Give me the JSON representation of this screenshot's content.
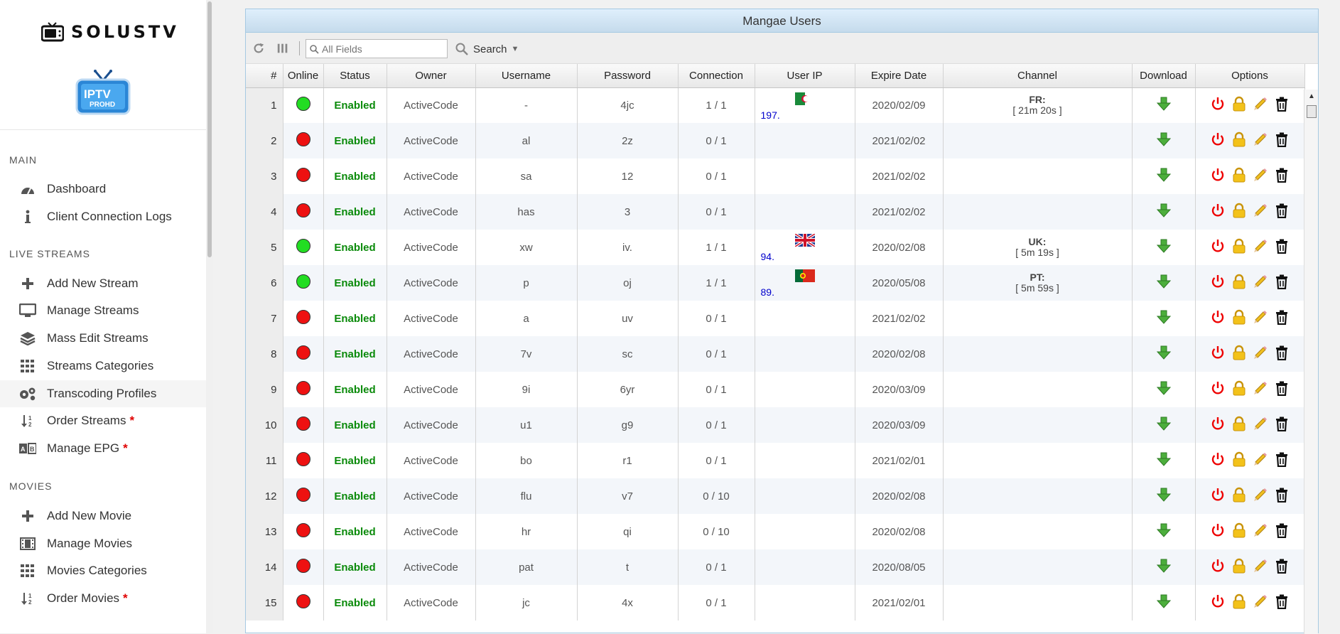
{
  "brand": {
    "name": "SOLUSTV",
    "logo_text_top": "IPTV",
    "logo_text_bottom": "PROHD"
  },
  "sidebar": {
    "sections": [
      {
        "title": "MAIN",
        "items": [
          {
            "label": "Dashboard",
            "icon": "gauge-icon",
            "required": false
          },
          {
            "label": "Client Connection Logs",
            "icon": "info-icon",
            "required": false
          }
        ]
      },
      {
        "title": "LIVE STREAMS",
        "items": [
          {
            "label": "Add New Stream",
            "icon": "plus-icon",
            "required": false
          },
          {
            "label": "Manage Streams",
            "icon": "monitor-icon",
            "required": false
          },
          {
            "label": "Mass Edit Streams",
            "icon": "layers-icon",
            "required": false
          },
          {
            "label": "Streams Categories",
            "icon": "grid-icon",
            "required": false
          },
          {
            "label": "Transcoding Profiles",
            "icon": "gears-icon",
            "required": false
          },
          {
            "label": "Order Streams",
            "icon": "sort-icon",
            "required": true
          },
          {
            "label": "Manage EPG",
            "icon": "epg-icon",
            "required": true
          }
        ]
      },
      {
        "title": "MOVIES",
        "items": [
          {
            "label": "Add New Movie",
            "icon": "plus-icon",
            "required": false
          },
          {
            "label": "Manage Movies",
            "icon": "film-icon",
            "required": false
          },
          {
            "label": "Movies Categories",
            "icon": "grid-icon",
            "required": false
          },
          {
            "label": "Order Movies",
            "icon": "sort-icon",
            "required": true
          }
        ]
      }
    ],
    "required_mark": "*"
  },
  "panel": {
    "title": "Mangae Users",
    "search": {
      "placeholder": "All Fields",
      "button_label": "Search"
    },
    "columns": [
      "#",
      "Online",
      "Status",
      "Owner",
      "Username",
      "Password",
      "Connection",
      "User IP",
      "Expire Date",
      "Channel",
      "Download",
      "Options"
    ],
    "rows": [
      {
        "num": "1",
        "online": true,
        "status": "Enabled",
        "owner": "ActiveCode",
        "username": "-",
        "password": "4jc",
        "connection": "1 / 1",
        "ip": "197.",
        "flag": "algeria",
        "expire": "2020/02/09",
        "channel_name": "FR:",
        "channel_time": "[ 21m 20s ]"
      },
      {
        "num": "2",
        "online": false,
        "status": "Enabled",
        "owner": "ActiveCode",
        "username": "al",
        "password": "2z",
        "connection": "0 / 1",
        "ip": "",
        "flag": "",
        "expire": "2021/02/02",
        "channel_name": "",
        "channel_time": ""
      },
      {
        "num": "3",
        "online": false,
        "status": "Enabled",
        "owner": "ActiveCode",
        "username": "sa",
        "password": "12",
        "connection": "0 / 1",
        "ip": "",
        "flag": "",
        "expire": "2021/02/02",
        "channel_name": "",
        "channel_time": ""
      },
      {
        "num": "4",
        "online": false,
        "status": "Enabled",
        "owner": "ActiveCode",
        "username": "has",
        "password": "3",
        "connection": "0 / 1",
        "ip": "",
        "flag": "",
        "expire": "2021/02/02",
        "channel_name": "",
        "channel_time": ""
      },
      {
        "num": "5",
        "online": true,
        "status": "Enabled",
        "owner": "ActiveCode",
        "username": "xw",
        "password": "iv.",
        "connection": "1 / 1",
        "ip": "94.",
        "flag": "uk",
        "expire": "2020/02/08",
        "channel_name": "UK:",
        "channel_time": "[ 5m 19s ]"
      },
      {
        "num": "6",
        "online": true,
        "status": "Enabled",
        "owner": "ActiveCode",
        "username": "p",
        "password": "oj",
        "connection": "1 / 1",
        "ip": "89.",
        "flag": "portugal",
        "expire": "2020/05/08",
        "channel_name": "PT:",
        "channel_time": "[ 5m 59s ]"
      },
      {
        "num": "7",
        "online": false,
        "status": "Enabled",
        "owner": "ActiveCode",
        "username": "a",
        "password": "uv",
        "connection": "0 / 1",
        "ip": "",
        "flag": "",
        "expire": "2021/02/02",
        "channel_name": "",
        "channel_time": ""
      },
      {
        "num": "8",
        "online": false,
        "status": "Enabled",
        "owner": "ActiveCode",
        "username": "7v",
        "password": "sc",
        "connection": "0 / 1",
        "ip": "",
        "flag": "",
        "expire": "2020/02/08",
        "channel_name": "",
        "channel_time": ""
      },
      {
        "num": "9",
        "online": false,
        "status": "Enabled",
        "owner": "ActiveCode",
        "username": "9i",
        "password": "6yr",
        "connection": "0 / 1",
        "ip": "",
        "flag": "",
        "expire": "2020/03/09",
        "channel_name": "",
        "channel_time": ""
      },
      {
        "num": "10",
        "online": false,
        "status": "Enabled",
        "owner": "ActiveCode",
        "username": "u1",
        "password": "g9",
        "connection": "0 / 1",
        "ip": "",
        "flag": "",
        "expire": "2020/03/09",
        "channel_name": "",
        "channel_time": ""
      },
      {
        "num": "11",
        "online": false,
        "status": "Enabled",
        "owner": "ActiveCode",
        "username": "bo",
        "password": "r1",
        "connection": "0 / 1",
        "ip": "",
        "flag": "",
        "expire": "2021/02/01",
        "channel_name": "",
        "channel_time": ""
      },
      {
        "num": "12",
        "online": false,
        "status": "Enabled",
        "owner": "ActiveCode",
        "username": "flu",
        "password": "v7",
        "connection": "0 / 10",
        "ip": "",
        "flag": "",
        "expire": "2020/02/08",
        "channel_name": "",
        "channel_time": ""
      },
      {
        "num": "13",
        "online": false,
        "status": "Enabled",
        "owner": "ActiveCode",
        "username": "hr",
        "password": "qi",
        "connection": "0 / 10",
        "ip": "",
        "flag": "",
        "expire": "2020/02/08",
        "channel_name": "",
        "channel_time": ""
      },
      {
        "num": "14",
        "online": false,
        "status": "Enabled",
        "owner": "ActiveCode",
        "username": "pat",
        "password": "t",
        "connection": "0 / 1",
        "ip": "",
        "flag": "",
        "expire": "2020/08/05",
        "channel_name": "",
        "channel_time": ""
      },
      {
        "num": "15",
        "online": false,
        "status": "Enabled",
        "owner": "ActiveCode",
        "username": "jc",
        "password": "4x",
        "connection": "0 / 1",
        "ip": "",
        "flag": "",
        "expire": "2021/02/01",
        "channel_name": "",
        "channel_time": ""
      }
    ]
  },
  "colors": {
    "online": "#22dd22",
    "offline": "#ee1111",
    "enabled": "#0a8a0a",
    "ip": "#0000cc",
    "required": "#e00000"
  }
}
